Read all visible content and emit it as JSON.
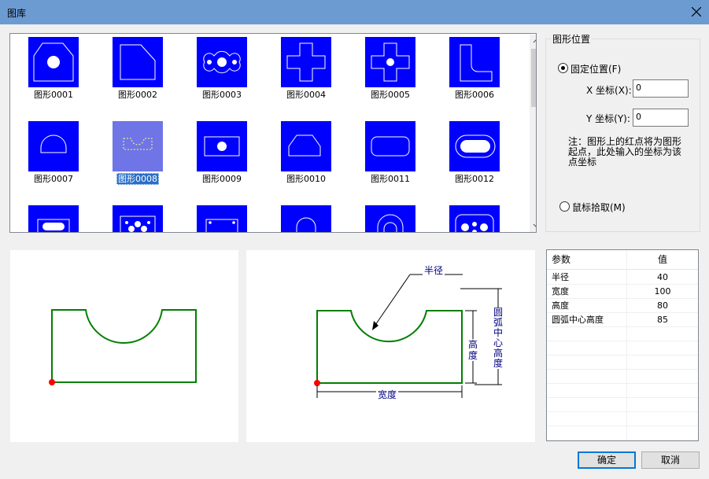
{
  "window": {
    "title": "图库"
  },
  "gallery": {
    "items": [
      {
        "label": "图形0001",
        "shape": "rect-chamfer-hole-icon"
      },
      {
        "label": "图形0002",
        "shape": "rect-chamfer-corner-icon"
      },
      {
        "label": "图形0003",
        "shape": "three-hole-flange-icon"
      },
      {
        "label": "图形0004",
        "shape": "cross-icon"
      },
      {
        "label": "图形0005",
        "shape": "cross-hole-icon"
      },
      {
        "label": "图形0006",
        "shape": "l-bracket-icon"
      },
      {
        "label": "图形0007",
        "shape": "arch-icon"
      },
      {
        "label": "图形0008",
        "shape": "notched-rect-icon",
        "selected": true
      },
      {
        "label": "图形0009",
        "shape": "rect-hole-icon"
      },
      {
        "label": "图形0010",
        "shape": "chamfer-top-icon"
      },
      {
        "label": "图形0011",
        "shape": "rounded-rect-icon"
      },
      {
        "label": "图形0012",
        "shape": "slot-in-rounded-icon"
      },
      {
        "label": "",
        "shape": "rect-slot-icon"
      },
      {
        "label": "",
        "shape": "multi-hole-plate-icon"
      },
      {
        "label": "",
        "shape": "rect-corner-holes-icon"
      },
      {
        "label": "",
        "shape": "arch-small-icon"
      },
      {
        "label": "",
        "shape": "arch-inner-icon"
      },
      {
        "label": "",
        "shape": "rounded-multi-hole-icon"
      }
    ]
  },
  "position_group": {
    "title": "图形位置",
    "fixed_label": "固定位置(F)",
    "x_label": "X 坐标(X):",
    "x_value": "0",
    "y_label": "Y 坐标(Y):",
    "y_value": "0",
    "note": "注：图形上的红点将为图形起点，此处输入的坐标为该点坐标",
    "mouse_label": "鼠标拾取(M)"
  },
  "diagram": {
    "radius": "半径",
    "height": "高度",
    "arc_center_height": "圆弧中心高度",
    "width": "宽度"
  },
  "params": {
    "col_param": "参数",
    "col_value": "值",
    "rows": [
      {
        "name": "半径",
        "value": "40"
      },
      {
        "name": "宽度",
        "value": "100"
      },
      {
        "name": "高度",
        "value": "80"
      },
      {
        "name": "圆弧中心高度",
        "value": "85"
      }
    ]
  },
  "buttons": {
    "ok": "确定",
    "cancel": "取消"
  },
  "colors": {
    "thumb_bg": "#0000ff",
    "shape_line": "#008000",
    "origin_point": "#ff0000",
    "dimension": "#000080"
  }
}
